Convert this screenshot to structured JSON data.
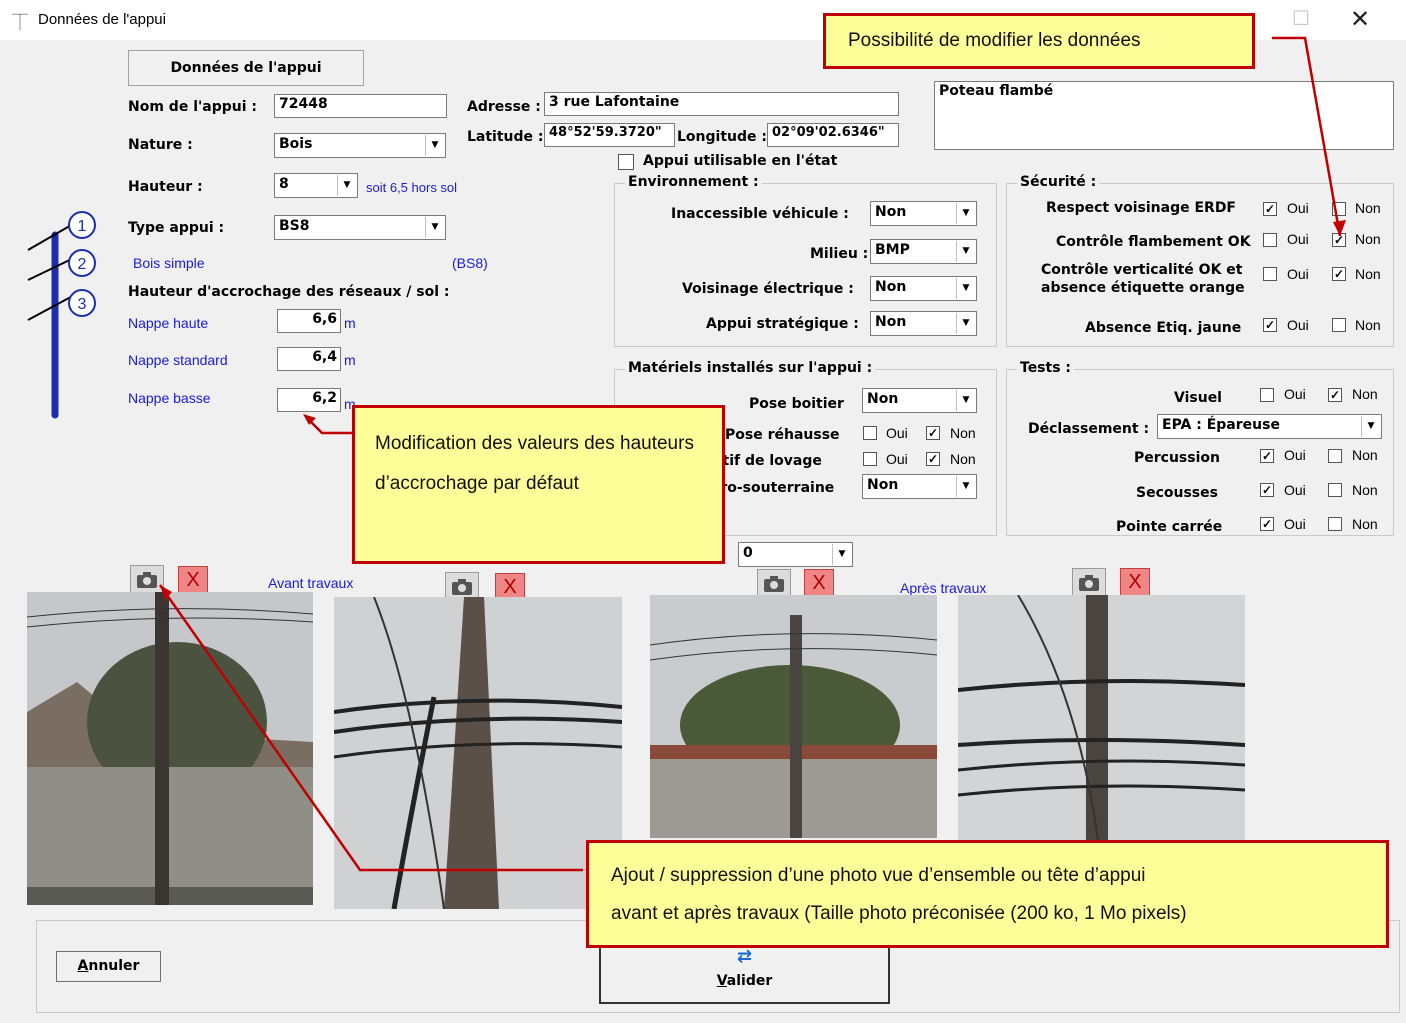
{
  "window": {
    "title": "Données de l'appui",
    "close": "✕",
    "maximize": "☐"
  },
  "header_box": "Données de l'appui",
  "form": {
    "nom_label": "Nom de l'appui :",
    "nom_value": "72448",
    "nature_label": "Nature :",
    "nature_value": "Bois",
    "hauteur_label": "Hauteur :",
    "hauteur_value": "8",
    "hauteur_note": "soit 6,5 hors sol",
    "type_label": "Type appui :",
    "type_value": "BS8",
    "type_desc": "Bois simple",
    "type_code": "(BS8)",
    "accrochage_label": "Hauteur d'accrochage des réseaux / sol :",
    "nappes": [
      {
        "label": "Nappe haute",
        "value": "6,6",
        "unit": "m"
      },
      {
        "label": "Nappe standard",
        "value": "6,4",
        "unit": "m"
      },
      {
        "label": "Nappe basse",
        "value": "6,2",
        "unit": "m"
      }
    ],
    "adresse_label": "Adresse :",
    "adresse_value": "3 rue Lafontaine",
    "latitude_label": "Latitude :",
    "latitude_value": "48°52'59.3720\"",
    "longitude_label": "Longitude :",
    "longitude_value": "02°09'02.6346\"",
    "appui_utilisable": "Appui utilisable en l'état",
    "comment": "Poteau flambé"
  },
  "diagram": {
    "n1": "1",
    "n2": "2",
    "n3": "3"
  },
  "environnement": {
    "title": "Environnement :",
    "rows": [
      {
        "label": "Inaccessible véhicule :",
        "value": "Non"
      },
      {
        "label": "Milieu :",
        "value": "BMP"
      },
      {
        "label": "Voisinage électrique :",
        "value": "Non"
      },
      {
        "label": "Appui stratégique :",
        "value": "Non"
      }
    ]
  },
  "materiels": {
    "title": "Matériels installés sur l'appui :",
    "pose_boitier_label": "Pose boitier",
    "pose_boitier_value": "Non",
    "pose_rehausse_label": "Pose réhausse",
    "dispositif_label": "Dispositif de lovage",
    "aero_label": "Aéro-souterraine",
    "aero_value": "Non",
    "oui": "Oui",
    "non": "Non",
    "extra_value": "0"
  },
  "securite": {
    "title": "Sécurité :",
    "oui": "Oui",
    "non": "Non",
    "rows": [
      {
        "label": "Respect voisinage ERDF",
        "oui": true,
        "non": false
      },
      {
        "label": "Contrôle flambement OK",
        "oui": false,
        "non": true
      },
      {
        "label1": "Contrôle verticalité OK et",
        "label2": "absence étiquette orange",
        "oui": false,
        "non": true
      },
      {
        "label": "Absence Etiq. jaune",
        "oui": true,
        "non": false
      }
    ]
  },
  "tests": {
    "title": "Tests :",
    "oui": "Oui",
    "non": "Non",
    "visuel_label": "Visuel",
    "declassement_label": "Déclassement :",
    "declassement_value": "EPA : Épareuse",
    "percussion_label": "Percussion",
    "secousses_label": "Secousses",
    "pointe_label": "Pointe carrée"
  },
  "photos": {
    "avant": "Avant travaux",
    "apres": "Après travaux",
    "delete": "X"
  },
  "buttons": {
    "annuler": "Annuler",
    "annuler_key": "A",
    "annuler_rest": "nnuler",
    "valider_key": "V",
    "valider_rest": "alider"
  },
  "callouts": {
    "modifier": "Possibilité de modifier les données",
    "hauteurs": "Modification des valeurs des hauteurs d’accrochage par défaut",
    "photo_line1": "Ajout / suppression d’une photo vue d’ensemble ou tête d’appui",
    "photo_line2": "avant et après travaux (Taille photo préconisée (200 ko, 1 Mo pixels)"
  },
  "colors": {
    "label_blue": "#1a1adf",
    "callout_bg": "#ffff99",
    "callout_border": "#c00000",
    "pole_blue": "#1a2db0"
  }
}
